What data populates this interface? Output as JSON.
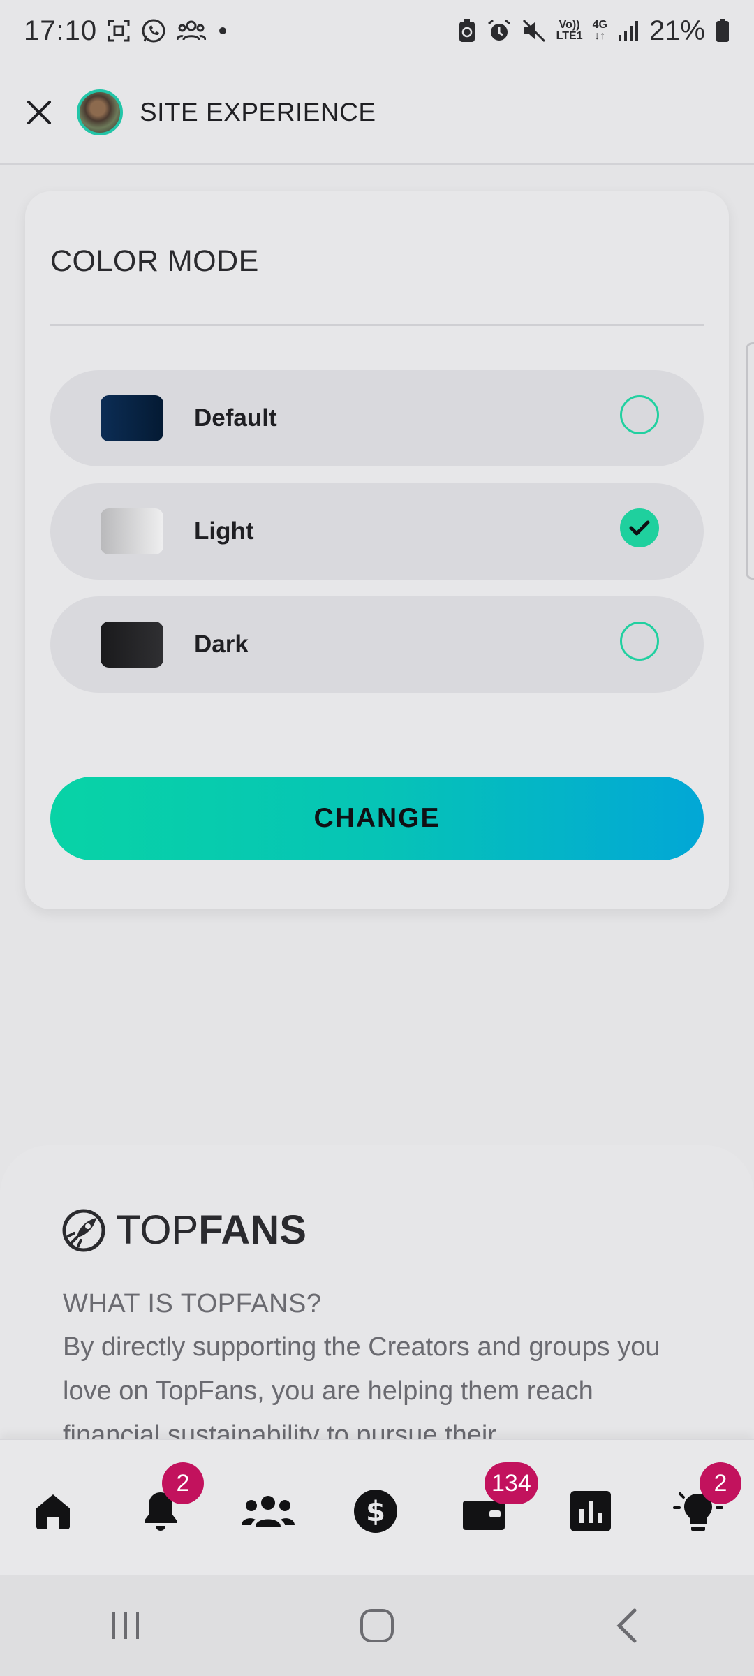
{
  "status_bar": {
    "time": "17:10",
    "network_top": "Vo))",
    "network_bottom": "LTE1",
    "network_type": "4G",
    "battery": "21%"
  },
  "header": {
    "title": "SITE EXPERIENCE"
  },
  "color_mode": {
    "title": "COLOR MODE",
    "options": [
      {
        "label": "Default",
        "selected": false
      },
      {
        "label": "Light",
        "selected": true
      },
      {
        "label": "Dark",
        "selected": false
      }
    ],
    "button_label": "CHANGE"
  },
  "about": {
    "logo_light": "TOP",
    "logo_bold": "FANS",
    "heading": "WHAT IS TOPFANS?",
    "text": "By directly supporting the Creators and groups you love on TopFans, you are helping them reach financial sustainability to pursue their"
  },
  "bottom_nav": {
    "badges": {
      "notifications": "2",
      "wallet": "134",
      "tips": "2"
    }
  },
  "colors": {
    "accent": "#1fd09e",
    "badge": "#c2125d",
    "button_start": "#08d3a6",
    "button_end": "#02a7d6"
  }
}
